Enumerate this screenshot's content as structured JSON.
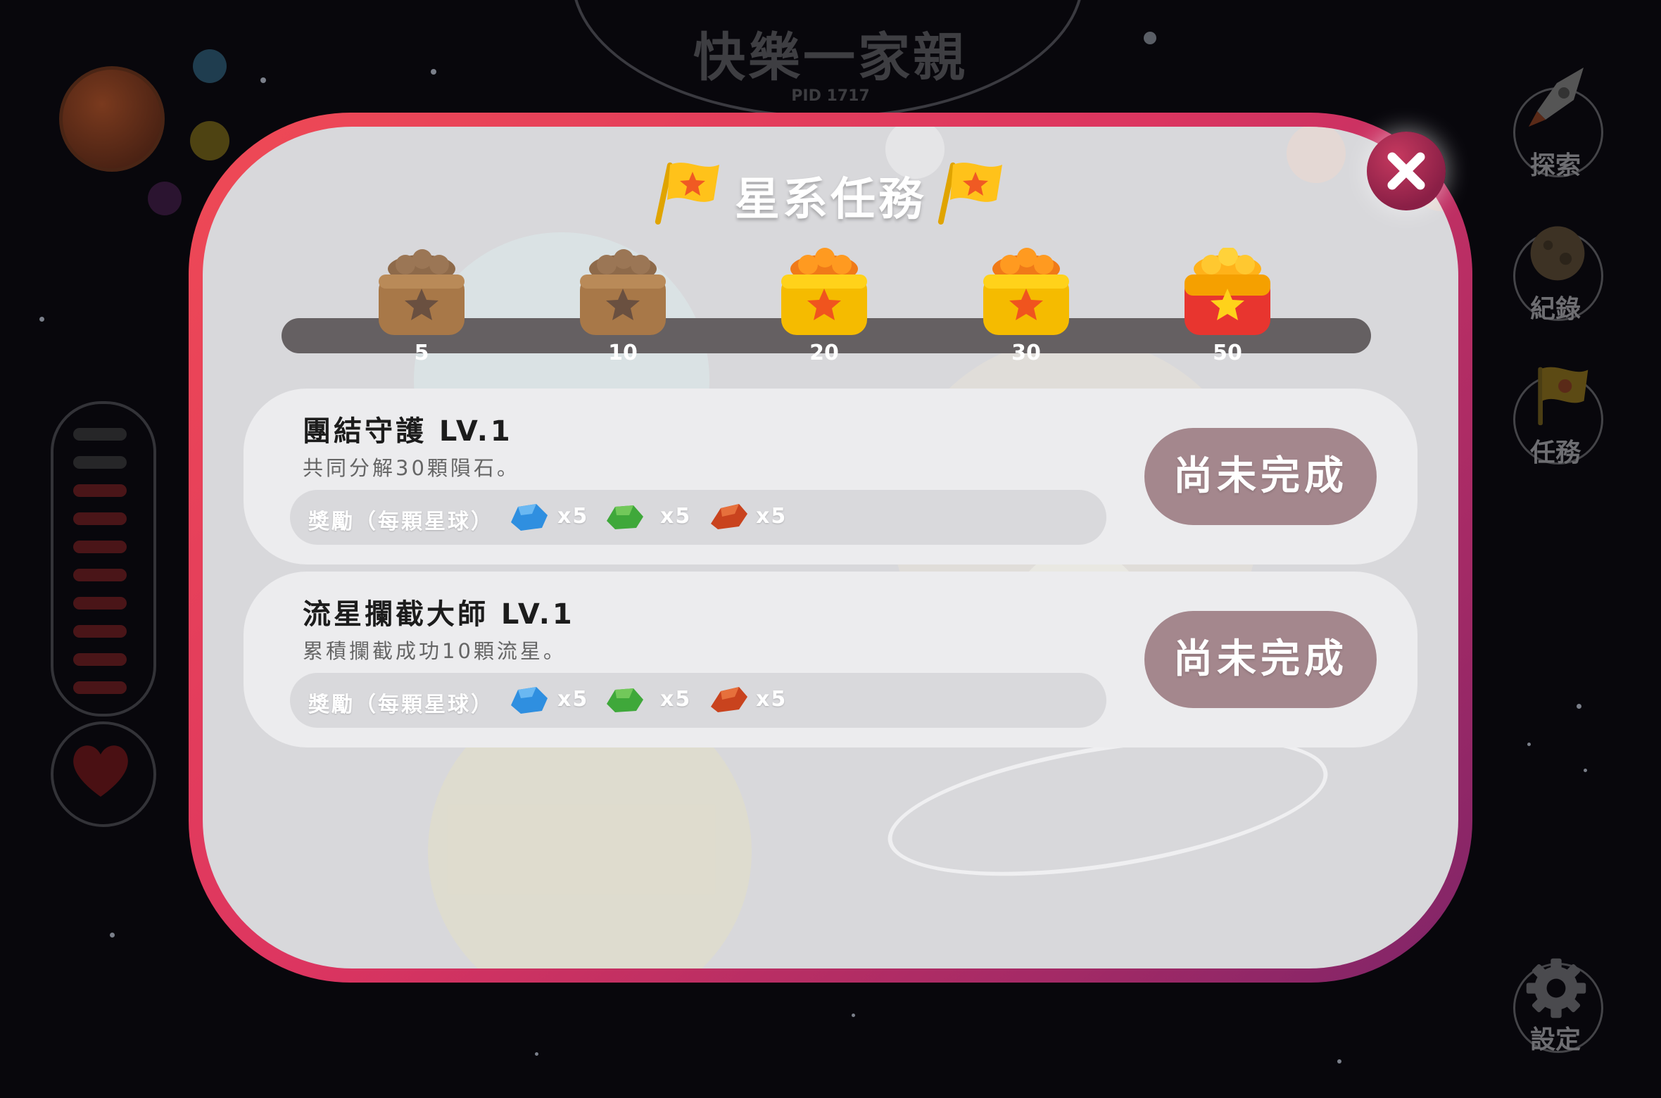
{
  "background": {
    "room_title": "快樂一家親",
    "room_pid": "PID 1717",
    "side_menu": [
      {
        "label": "探索",
        "icon": "rocket-icon"
      },
      {
        "label": "紀錄",
        "icon": "asteroid-icon"
      },
      {
        "label": "任務",
        "icon": "flag-icon"
      },
      {
        "label": "設定",
        "icon": "gear-icon"
      }
    ],
    "energy_level": 0.8
  },
  "modal": {
    "title": "星系任務",
    "close_icon": "close-icon",
    "milestones": [
      {
        "value": "5",
        "state": "locked"
      },
      {
        "value": "10",
        "state": "locked"
      },
      {
        "value": "20",
        "state": "unlocked"
      },
      {
        "value": "30",
        "state": "unlocked"
      },
      {
        "value": "50",
        "state": "unlocked-special"
      }
    ],
    "missions": [
      {
        "name": "團結守護 LV.1",
        "description": "共同分解30顆隕石。",
        "reward_label": "獎勵（每顆星球）",
        "rewards": [
          {
            "gem": "blue-gem-icon",
            "color": "#2f8fe0",
            "count": "x5"
          },
          {
            "gem": "green-gem-icon",
            "color": "#3fa83a",
            "count": "x5"
          },
          {
            "gem": "red-gem-icon",
            "color": "#c9431e",
            "count": "x5"
          }
        ],
        "status": "尚未完成"
      },
      {
        "name": "流星攔截大師 LV.1",
        "description": "累積攔截成功10顆流星。",
        "reward_label": "獎勵（每顆星球）",
        "rewards": [
          {
            "gem": "blue-gem-icon",
            "color": "#2f8fe0",
            "count": "x5"
          },
          {
            "gem": "green-gem-icon",
            "color": "#3fa83a",
            "count": "x5"
          },
          {
            "gem": "red-gem-icon",
            "color": "#c9431e",
            "count": "x5"
          }
        ],
        "status": "尚未完成"
      }
    ]
  },
  "colors": {
    "modal_border_start": "#ef4a55",
    "modal_border_end": "#7e2468",
    "status_button": "#a4878d",
    "close_button": "#a92a52"
  }
}
